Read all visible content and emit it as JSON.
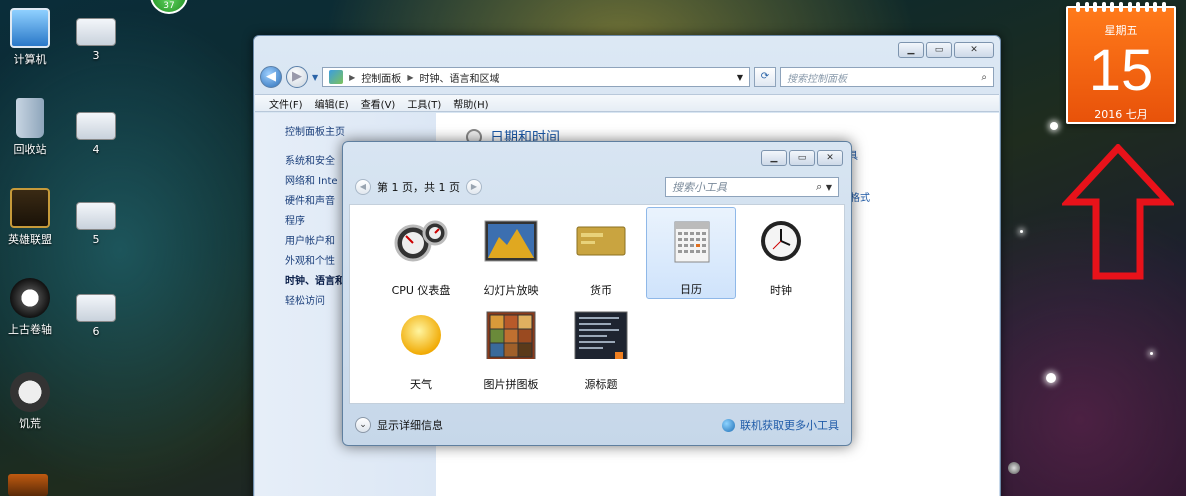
{
  "desktop": {
    "icons": [
      {
        "label": "计算机"
      },
      {
        "label": "回收站"
      },
      {
        "label": "英雄联盟"
      },
      {
        "label": "上古卷轴"
      },
      {
        "label": "饥荒"
      },
      {
        "label": "3"
      },
      {
        "label": "4"
      },
      {
        "label": "5"
      },
      {
        "label": "6"
      }
    ],
    "badge_count": "37"
  },
  "window": {
    "breadcrumb": [
      "控制面板",
      "时钟、语言和区域"
    ],
    "search_placeholder": "搜索控制面板",
    "menu": [
      "文件(F)",
      "编辑(E)",
      "查看(V)",
      "工具(T)",
      "帮助(H)"
    ],
    "sidebar": {
      "home": "控制面板主页",
      "items": [
        {
          "label": "系统和安全",
          "active": false
        },
        {
          "label": "网络和 Inte",
          "active": false
        },
        {
          "label": "硬件和声音",
          "active": false
        },
        {
          "label": "程序",
          "active": false
        },
        {
          "label": "用户帐户和",
          "active": false
        },
        {
          "label": "外观和个性",
          "active": false
        },
        {
          "label": "时钟、语言和",
          "active": true
        },
        {
          "label": "轻松访问",
          "active": false
        }
      ]
    },
    "content": {
      "section_title": "日期和时间",
      "link1": "具",
      "link2": "数字格式"
    }
  },
  "gadget_dialog": {
    "pager": "第 1 页，共 1 页",
    "search_placeholder": "搜索小工具",
    "gadgets": [
      {
        "label": "CPU 仪表盘",
        "icon": "cpu-meter-icon",
        "selected": false
      },
      {
        "label": "幻灯片放映",
        "icon": "slideshow-icon",
        "selected": false
      },
      {
        "label": "货币",
        "icon": "currency-icon",
        "selected": false
      },
      {
        "label": "日历",
        "icon": "calendar-icon",
        "selected": true
      },
      {
        "label": "时钟",
        "icon": "clock-icon",
        "selected": false
      },
      {
        "label": "天气",
        "icon": "weather-icon",
        "selected": false
      },
      {
        "label": "图片拼图板",
        "icon": "picture-puzzle-icon",
        "selected": false
      },
      {
        "label": "源标题",
        "icon": "feed-headlines-icon",
        "selected": false
      }
    ],
    "details_label": "显示详细信息",
    "online_label": "联机获取更多小工具"
  },
  "calendar_gadget": {
    "weekday": "星期五",
    "day": "15",
    "year_month": "2016 七月"
  },
  "colors": {
    "calendar_orange": "#f26a12",
    "arrow_red": "#e8121a",
    "link_blue": "#1e5aa8"
  }
}
